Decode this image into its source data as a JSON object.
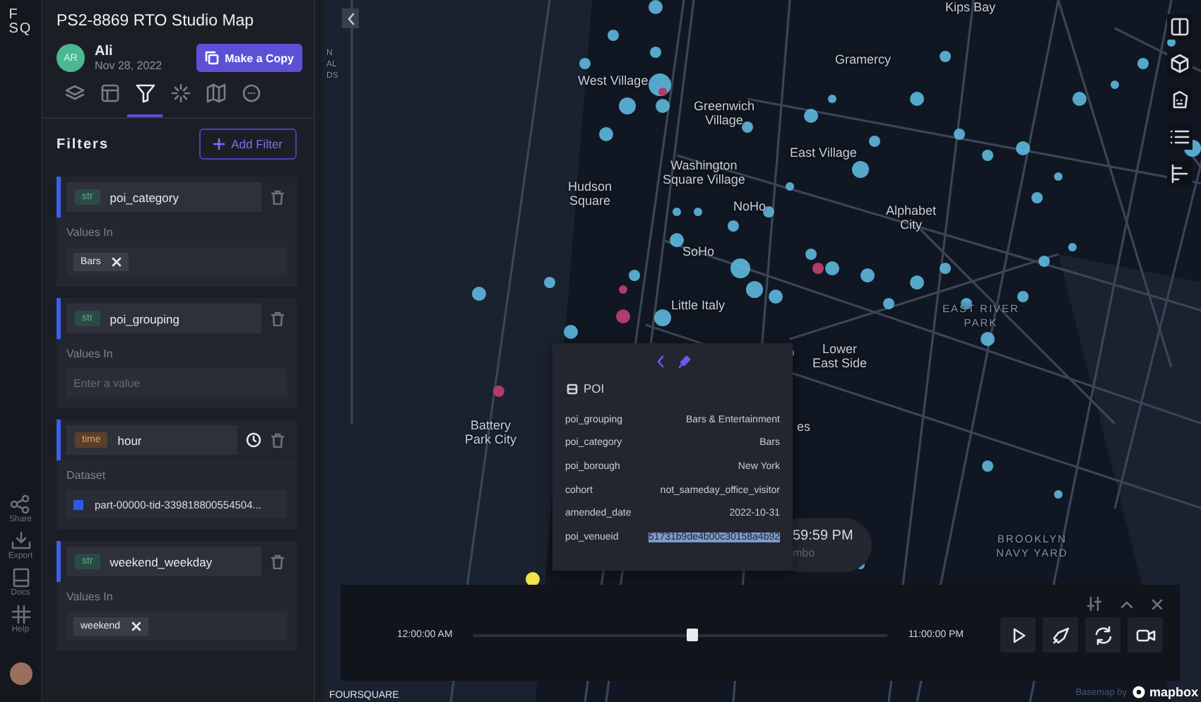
{
  "rail": {
    "logo": "F\nSQ",
    "actions": [
      {
        "label": "Share"
      },
      {
        "label": "Export"
      },
      {
        "label": "Docs"
      },
      {
        "label": "Help"
      }
    ]
  },
  "header": {
    "title": "PS2-8869 RTO Studio Map",
    "user": {
      "initials": "AR",
      "name": "Ali",
      "date": "Nov 28, 2022"
    },
    "copy_button": "Make a Copy"
  },
  "tabs": [
    {
      "selected": false
    },
    {
      "selected": false
    },
    {
      "selected": true
    },
    {
      "selected": false
    },
    {
      "selected": false
    },
    {
      "selected": false
    }
  ],
  "filters": {
    "title": "Filters",
    "add_button": "Add Filter",
    "items": [
      {
        "type": "str",
        "field": "poi_category",
        "kind": "values",
        "label": "Values In",
        "chips": [
          "Bars"
        ]
      },
      {
        "type": "str",
        "field": "poi_grouping",
        "kind": "values",
        "label": "Values In",
        "placeholder": "Enter a value"
      },
      {
        "type": "time",
        "field": "hour",
        "kind": "dataset",
        "label": "Dataset",
        "dataset": "part-00000-tid-339818800554504...",
        "color": "#2b5ce6"
      },
      {
        "type": "str",
        "field": "weekend_weekday",
        "kind": "values",
        "label": "Values In",
        "chips": [
          "weekend"
        ]
      }
    ]
  },
  "map": {
    "labels": [
      {
        "text": "Kips Bay",
        "kind": "area"
      },
      {
        "text": "West Village",
        "kind": "area"
      },
      {
        "text": "Gramercy",
        "kind": "area"
      },
      {
        "text": "Greenwich\nVillage",
        "kind": "area"
      },
      {
        "text": "East Village",
        "kind": "area"
      },
      {
        "text": "Washington\nSquare Village",
        "kind": "area"
      },
      {
        "text": "Hudson\nSquare",
        "kind": "area"
      },
      {
        "text": "NoHo",
        "kind": "area"
      },
      {
        "text": "Alphabet\nCity",
        "kind": "area"
      },
      {
        "text": "SoHo",
        "kind": "area"
      },
      {
        "text": "Little Italy",
        "kind": "area"
      },
      {
        "text": "EAST RIVER\nPARK",
        "kind": "park"
      },
      {
        "text": "Lower\nEast Side",
        "kind": "area"
      },
      {
        "text": "Battery\nPark City",
        "kind": "area"
      },
      {
        "text": "BROOKLYN\nNAVY YARD",
        "kind": "park"
      },
      {
        "text": "N\nAL\nDS",
        "kind": "edge"
      },
      {
        "text": "es",
        "kind": "area"
      }
    ],
    "time_overlay": "59:59 PM",
    "overlay_fragment": "mbo",
    "brand": "FOURSQUARE",
    "attribution": "Basemap by",
    "mapbox": "mapbox"
  },
  "tooltip": {
    "title": "POI",
    "rows": [
      {
        "key": "poi_grouping",
        "value": "Bars & Entertainment",
        "highlighted": false
      },
      {
        "key": "poi_category",
        "value": "Bars",
        "highlighted": false
      },
      {
        "key": "poi_borough",
        "value": "New York",
        "highlighted": false
      },
      {
        "key": "cohort",
        "value": "not_sameday_office_visitor",
        "highlighted": false
      },
      {
        "key": "amended_date",
        "value": "2022-10-31",
        "highlighted": false
      },
      {
        "key": "poi_venueid",
        "value": "51731b9de4b00c30158a4b92",
        "highlighted": true
      }
    ]
  },
  "timeline": {
    "start": "12:00:00 AM",
    "end": "11:00:00 PM",
    "level": 0.53
  }
}
